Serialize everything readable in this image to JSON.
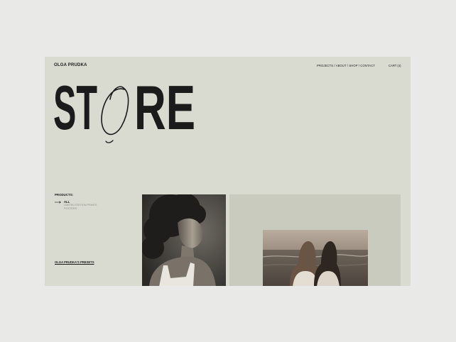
{
  "header": {
    "brand": "OLGA PRUDKA",
    "nav": {
      "projects": "PROJECTS",
      "about": "ABOUT",
      "shop": "SHOP",
      "contact": "CONTACT",
      "separator": " / "
    },
    "cart": "CART (4)"
  },
  "hero": {
    "title": "STORE",
    "script_letter": "O"
  },
  "sidebar": {
    "products_label": "PRODUCTS:",
    "filters": [
      {
        "label": "ALL",
        "active": true
      },
      {
        "label": "LIMITED EDITION PRINTS",
        "active": false
      },
      {
        "label": "POSTERS",
        "active": false
      }
    ],
    "presets_link": "OLGA PRUDKA'S PRESETS"
  },
  "products": [
    {
      "name": "portrait-curly-hair",
      "icon": "photo-portrait"
    },
    {
      "name": "two-women-beach",
      "icon": "photo-beach"
    }
  ],
  "colors": {
    "page_bg": "#e9e9e8",
    "frame_bg": "#d9dbd1",
    "text": "#1b1b1b",
    "muted": "#8d8f88",
    "card2_bg": "#c9cbbe"
  }
}
